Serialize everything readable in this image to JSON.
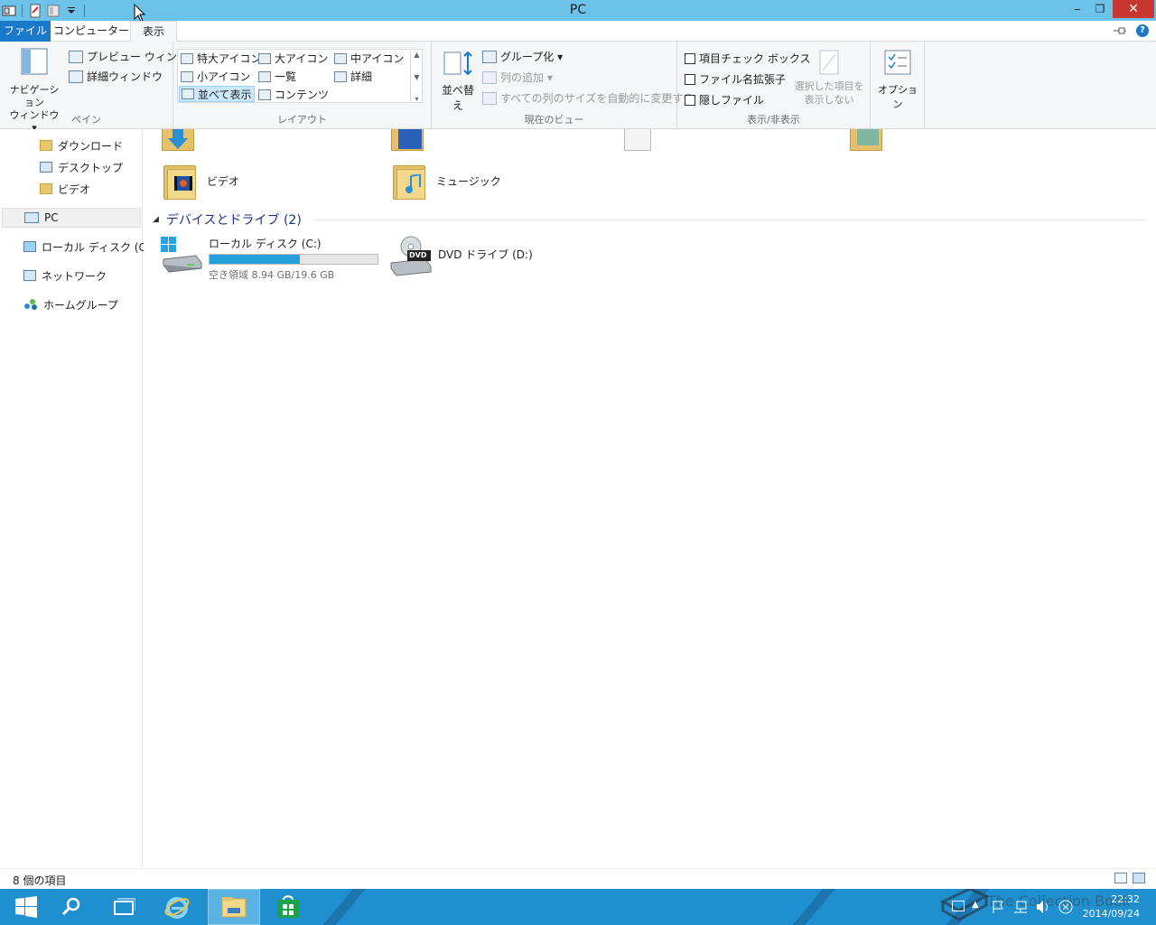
{
  "window": {
    "title": "PC",
    "minimize": "‒",
    "restore": "❐",
    "close": "✕"
  },
  "tabs": {
    "file": "ファイル",
    "computer": "コンピューター",
    "view": "表示"
  },
  "ribbon": {
    "pane": {
      "nav_label": "ナビゲーション\nウィンドウ ▾",
      "nav_line1": "ナビゲーション",
      "nav_line2": "ウィンドウ ▾",
      "preview": "プレビュー ウィンドウ",
      "details": "詳細ウィンドウ",
      "group": "ペイン"
    },
    "layout": {
      "items": [
        "特大アイコン",
        "大アイコン",
        "中アイコン",
        "小アイコン",
        "一覧",
        "詳細",
        "並べて表示",
        "コンテンツ"
      ],
      "group": "レイアウト"
    },
    "current_view": {
      "sort": "並べ替え",
      "group_by": "グループ化 ▾",
      "add_column": "列の追加 ▾",
      "fit_columns": "すべての列のサイズを自動的に変更する",
      "group": "現在のビュー"
    },
    "show_hide": {
      "item_checkboxes": "項目チェック ボックス",
      "file_extensions": "ファイル名拡張子",
      "hidden_items": "隠しファイル",
      "hide_selected_line1": "選択した項目を",
      "hide_selected_line2": "表示しない",
      "group": "表示/非表示"
    },
    "options": "オプション"
  },
  "nav": {
    "items": [
      "ダウンロード",
      "デスクトップ",
      "ビデオ",
      "PC",
      "ローカル ディスク (C:)",
      "ネットワーク",
      "ホームグループ"
    ]
  },
  "content": {
    "folders": [
      "ビデオ",
      "ミュージック"
    ],
    "devices_header": "デバイスとドライブ (2)",
    "drive_c": {
      "name": "ローカル ディスク (C:)",
      "free": "空き領域 8.94 GB/19.6 GB",
      "used_fraction": 0.54
    },
    "drive_d": {
      "name": "DVD ドライブ (D:)",
      "badge": "DVD"
    }
  },
  "status": {
    "count": "8 個の項目"
  },
  "taskbar": {
    "time": "22:32",
    "date": "2014/09/24",
    "watermark": "The Collection Book"
  },
  "colors": {
    "title_bar": "#6dc2e9",
    "file_tab": "#1979ca",
    "taskbar": "#1f8fcf",
    "drive_bar": "#26a0da"
  }
}
